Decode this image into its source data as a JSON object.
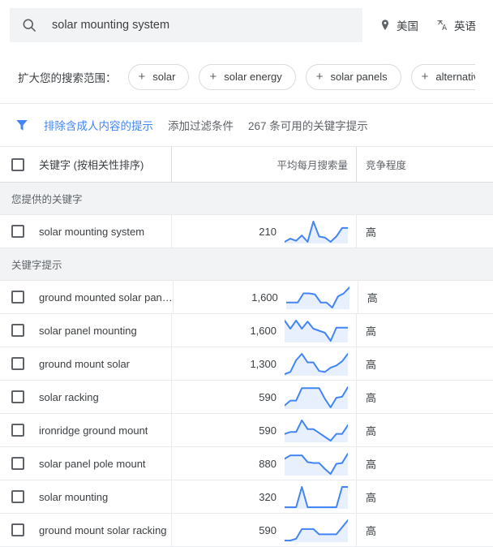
{
  "search": {
    "value": "solar mounting system",
    "placeholder": "",
    "icon": "search-icon",
    "location": {
      "label": "美国",
      "icon": "location-pin-icon"
    },
    "language": {
      "label": "英语",
      "icon": "translate-icon"
    }
  },
  "expand": {
    "label": "扩大您的搜索范围：",
    "chips": [
      {
        "plus": "+",
        "label": "solar"
      },
      {
        "plus": "+",
        "label": "solar energy"
      },
      {
        "plus": "+",
        "label": "solar panels"
      },
      {
        "plus": "+",
        "label": "alternative energy"
      }
    ]
  },
  "filters": {
    "icon": "filter-funnel-icon",
    "active_filter": "排除含成人内容的提示",
    "add_filter": "添加过滤条件",
    "count_text": "267 条可用的关键字提示",
    "accent_color": "#4285f4"
  },
  "table": {
    "headers": {
      "keyword": "关键字 (按相关性排序)",
      "volume": "平均每月搜索量",
      "competition": "竞争程度"
    },
    "groups": [
      {
        "title": "您提供的关键字",
        "rows": [
          {
            "keyword": "solar mounting system",
            "volume": "210",
            "competition": "高",
            "spark": [
              22,
              19,
              21,
              16,
              22,
              3,
              17,
              18,
              22,
              17,
              9,
              9
            ]
          }
        ]
      },
      {
        "title": "关键字提示",
        "rows": [
          {
            "keyword": "ground mounted solar pan…",
            "volume": "1,600",
            "competition": "高",
            "spark": [
              17,
              17,
              17,
              8,
              8,
              9,
              17,
              17,
              22,
              11,
              8,
              2
            ]
          },
          {
            "keyword": "solar panel mounting",
            "volume": "1,600",
            "competition": "高",
            "spark": [
              5,
              13,
              5,
              13,
              6,
              13,
              15,
              17,
              25,
              12,
              12,
              12
            ]
          },
          {
            "keyword": "ground mount solar",
            "volume": "1,300",
            "competition": "高",
            "spark": [
              21,
              19,
              8,
              2,
              10,
              10,
              18,
              19,
              15,
              13,
              9,
              2
            ]
          },
          {
            "keyword": "solar racking",
            "volume": "590",
            "competition": "高",
            "spark": [
              22,
              17,
              17,
              4,
              4,
              4,
              4,
              15,
              24,
              14,
              13,
              3
            ]
          },
          {
            "keyword": "ironridge ground mount",
            "volume": "590",
            "competition": "高",
            "spark": [
              18,
              16,
              16,
              4,
              13,
              13,
              17,
              21,
              25,
              18,
              18,
              9
            ]
          },
          {
            "keyword": "solar panel pole mount",
            "volume": "880",
            "competition": "高",
            "spark": [
              8,
              4,
              4,
              4,
              12,
              13,
              13,
              20,
              26,
              14,
              13,
              2
            ]
          },
          {
            "keyword": "solar mounting",
            "volume": "320",
            "competition": "高",
            "spark": [
              22,
              22,
              22,
              4,
              22,
              22,
              22,
              22,
              22,
              22,
              4,
              4
            ]
          },
          {
            "keyword": "ground mount solar racking",
            "volume": "590",
            "competition": "高",
            "spark": [
              24,
              24,
              22,
              11,
              11,
              11,
              17,
              17,
              17,
              17,
              9,
              1
            ]
          }
        ]
      }
    ]
  }
}
